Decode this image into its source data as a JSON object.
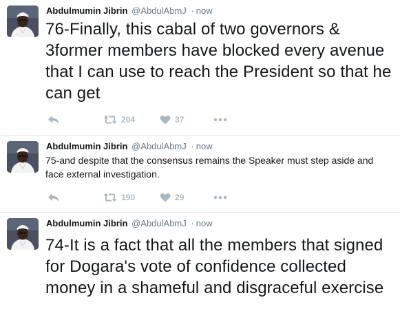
{
  "tweets": [
    {
      "name": "Abdulmumin Jibrin",
      "handle": "@AbdulAbmJ",
      "separator": "·",
      "time": "now",
      "text": "76-Finally, this cabal of two governors & 3former members have blocked every avenue that I can use to reach the President so that he can get",
      "retweets": "204",
      "likes": "37"
    },
    {
      "name": "Abdulmumin Jibrin",
      "handle": "@AbdulAbmJ",
      "separator": "·",
      "time": "now",
      "text": "75-and despite that the consensus remains the Speaker must step aside and face external investigation.",
      "retweets": "190",
      "likes": "29"
    },
    {
      "name": "Abdulmumin Jibrin",
      "handle": "@AbdulAbmJ",
      "separator": "·",
      "time": "now",
      "text": "74-It is a fact that all the members that signed for Dogara's vote of confidence collected money in a shameful and disgraceful exercise"
    }
  ],
  "icons": {
    "reply": "reply-icon",
    "retweet": "retweet-icon",
    "like": "heart-icon",
    "more": "more-dots-icon"
  },
  "colors": {
    "text": "#14171a",
    "secondary": "#657786",
    "action": "#aab8c2",
    "divider": "#e1e8ed"
  }
}
